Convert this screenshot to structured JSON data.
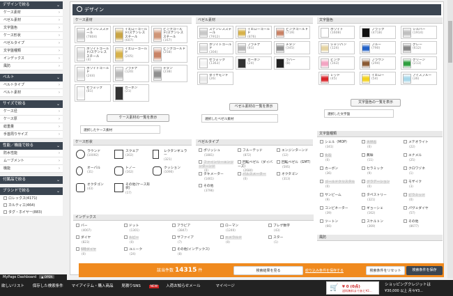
{
  "sidebar": [
    {
      "title": "デザインで絞る",
      "items": [
        "ケース素材",
        "ベゼル素材",
        "文字盤色",
        "ケース形状",
        "ベゼルタイプ",
        "文字盤種類",
        "インデックス",
        "風防"
      ]
    },
    {
      "title": "ベルト",
      "items": [
        "ベルトタイプ",
        "ベルト素材"
      ]
    },
    {
      "title": "サイズで絞る",
      "items": [
        "ケース径",
        "ケース厚",
        "総重量",
        "手首周りサイズ"
      ]
    },
    {
      "title": "性能／機能で絞る",
      "items": [
        "防水性能",
        "ムーブメント",
        "機能"
      ]
    },
    {
      "title": "付属品で絞る",
      "items": []
    },
    {
      "title": "ブランドで絞る",
      "checks": [
        "ロレックス(4171)",
        "カルティエ(464)",
        "タグ・ホイヤー(883)"
      ]
    }
  ],
  "main": {
    "title": "デザイン"
  },
  "case_material": {
    "title": "ケース素材",
    "swatches": [
      {
        "label": "ステンレススチール",
        "count": "(7804)",
        "color": "#c8c8c8"
      },
      {
        "label": "イエローゴールド/ステンレススチール",
        "count": "(607)",
        "color": "#c9a545"
      },
      {
        "label": "ピンクゴールド/ステンレススチール",
        "count": "(167)",
        "color": "#cf9577"
      },
      {
        "label": "ホワイトゴールド/ステンレススチール",
        "count": "(4)",
        "color": "#d8d8d8"
      },
      {
        "label": "イエローゴールド",
        "count": "(205)",
        "color": "#d7b24a"
      },
      {
        "label": "ピンクゴールド",
        "count": "(258)",
        "color": "#c98265"
      },
      {
        "label": "ホワイトゴールド",
        "count": "(244)",
        "color": "#dcdcdc"
      },
      {
        "label": "プラチナ",
        "count": "(120)",
        "color": "#b8b8b8"
      },
      {
        "label": "チタン",
        "count": "(238)",
        "color": "#8e8e8e"
      },
      {
        "label": "セラミック",
        "count": "(81)",
        "color": "#f3f3f3"
      },
      {
        "label": "カーボン",
        "count": "(21)",
        "color": "#333333"
      }
    ],
    "button": "ケース素材の一覧を表示",
    "selected": "選択したケース素材"
  },
  "bezel_material": {
    "title": "ベゼル素材",
    "swatches": [
      {
        "label": "ステンレススチール",
        "count": "(7912)",
        "color": "#c8c8c8"
      },
      {
        "label": "イエローゴールド",
        "count": "(876)",
        "color": "#d7b24a"
      },
      {
        "label": "ピンクゴールド",
        "count": "(719)",
        "color": "#c98265"
      },
      {
        "label": "ホワイトゴールド",
        "count": "(304)",
        "color": "#dcdcdc"
      },
      {
        "label": "プラチナ",
        "count": "(81)",
        "color": "#b8b8b8"
      },
      {
        "label": "チタン",
        "count": "(345)",
        "color": "#8e8e8e"
      },
      {
        "label": "セラミック",
        "count": "(1363)",
        "color": "#f3f3f3"
      },
      {
        "label": "カーボン",
        "count": "(24)",
        "color": "#333333"
      },
      {
        "label": "ラバー",
        "count": "(8)",
        "color": "#222222"
      },
      {
        "label": "ダイヤモンド",
        "count": "(26)",
        "color": "#e8e8e8"
      }
    ],
    "button": "ベゼル素材の一覧を表示",
    "selected": "選択したベゼル素材"
  },
  "dial_color": {
    "title": "文字盤色",
    "swatches": [
      {
        "label": "ホワイト",
        "count": "(1608)",
        "color": "#ffffff"
      },
      {
        "label": "ブラック",
        "count": "(4718)",
        "color": "#111111"
      },
      {
        "label": "シルバー",
        "count": "(1914)",
        "color": "#c0c0c0"
      },
      {
        "label": "シャンパン",
        "count": "(124)",
        "color": "#e5d3a1"
      },
      {
        "label": "ブルー",
        "count": "(790)",
        "color": "#1f5fc6"
      },
      {
        "label": "グレー",
        "count": "(612)",
        "color": "#888888"
      },
      {
        "label": "ピンク",
        "count": "(163)",
        "color": "#f3a4c2"
      },
      {
        "label": "ブラウン",
        "count": "(294)",
        "color": "#8a5a33"
      },
      {
        "label": "グリーン",
        "count": "(213)",
        "color": "#2e9f3e"
      },
      {
        "label": "レッド",
        "count": "(45)",
        "color": "#d9252b"
      },
      {
        "label": "イエロー",
        "count": "(54)",
        "color": "#f3d21f"
      },
      {
        "label": "アイスブルー",
        "count": "(36)",
        "color": "#a9d8ea"
      }
    ],
    "button": "文字盤色の一覧を表示",
    "selected": "選択した文字盤"
  },
  "case_shape": {
    "title": "ケース形状",
    "items": [
      {
        "label": "ラウンド",
        "count": "(10092)",
        "shape": "circle"
      },
      {
        "label": "スクエア",
        "count": "(302)",
        "shape": "square"
      },
      {
        "label": "レクタンギュラー",
        "count": "(321)",
        "shape": "rect"
      },
      {
        "label": "オーバル",
        "count": "(31)",
        "shape": "oval"
      },
      {
        "label": "トノー",
        "count": "(162)",
        "shape": "tonneau"
      },
      {
        "label": "クッション",
        "count": "(1090)",
        "shape": "cushion"
      },
      {
        "label": "オクタゴン",
        "count": "(43)",
        "shape": "octagon"
      },
      {
        "label": "その他(ケース形状)",
        "count": "(17)",
        "shape": "other"
      }
    ]
  },
  "bezel_type": {
    "title": "ベゼルタイプ",
    "items": [
      {
        "label": "ポリッシュ",
        "count": "(1881)",
        "disabled": false
      },
      {
        "label": "フルーテッド",
        "count": "(872)",
        "disabled": false
      },
      {
        "label": "エンジンターンド",
        "count": "(12)",
        "disabled": false
      },
      {
        "label": "ファインリーエンジンターンド",
        "count": "(0)",
        "disabled": true
      },
      {
        "label": "回転ベゼル（ダイバーズ）",
        "count": "(2680)",
        "disabled": false
      },
      {
        "label": "回転ベゼル（GMT）",
        "count": "(595)",
        "disabled": false
      },
      {
        "label": "タキメーター",
        "count": "(1461)",
        "disabled": false
      },
      {
        "label": "パルスメーター",
        "count": "(0)",
        "disabled": true
      },
      {
        "label": "オクタゴン",
        "count": "(313)",
        "disabled": false
      },
      {
        "label": "その他",
        "count": "(3796)",
        "disabled": false
      }
    ]
  },
  "dial_type": {
    "title": "文字盤種類",
    "items": [
      {
        "label": "シェル（MOP）",
        "count": "(341)",
        "disabled": false
      },
      {
        "label": "天然石",
        "count": "(0)",
        "disabled": true
      },
      {
        "label": "メテオライト",
        "count": "(22)",
        "disabled": false
      },
      {
        "label": "化石",
        "count": "(0)",
        "disabled": true
      },
      {
        "label": "無垢",
        "count": "(11)",
        "disabled": false
      },
      {
        "label": "エナメル",
        "count": "(25)",
        "disabled": false
      },
      {
        "label": "カーボン",
        "count": "(36)",
        "disabled": false
      },
      {
        "label": "セラミック",
        "count": "(9)",
        "disabled": false
      },
      {
        "label": "クロワゾネ",
        "count": "(1)",
        "disabled": false
      },
      {
        "label": "ゴールドクリスタル",
        "count": "(0)",
        "disabled": true
      },
      {
        "label": "グラデーション",
        "count": "(0)",
        "disabled": true
      },
      {
        "label": "モザイク",
        "count": "(3)",
        "disabled": false
      },
      {
        "label": "サンビーム",
        "count": "(9)",
        "disabled": false
      },
      {
        "label": "タペストリー",
        "count": "(321)",
        "disabled": false
      },
      {
        "label": "ピラミッド",
        "count": "(0)",
        "disabled": true
      },
      {
        "label": "コンビネーター",
        "count": "(39)",
        "disabled": false
      },
      {
        "label": "ギョーシェ",
        "count": "(162)",
        "disabled": false
      },
      {
        "label": "パヴェダイヤ",
        "count": "(57)",
        "disabled": false
      },
      {
        "label": "ツートン",
        "count": "(66)",
        "disabled": false
      },
      {
        "label": "スケルトン",
        "count": "(369)",
        "disabled": false
      },
      {
        "label": "その他",
        "count": "(8677)",
        "disabled": false
      }
    ]
  },
  "index": {
    "title": "インデックス",
    "items": [
      {
        "label": "バー",
        "count": "(4007)",
        "disabled": false
      },
      {
        "label": "ドット",
        "count": "(1301)",
        "disabled": false
      },
      {
        "label": "アラビア",
        "count": "(3847)",
        "disabled": false
      },
      {
        "label": "ローマン",
        "count": "(1240)",
        "disabled": false
      },
      {
        "label": "ブレゲ数字",
        "count": "(43)",
        "disabled": false
      },
      {
        "label": "ダイヤ",
        "count": "(823)",
        "disabled": false
      },
      {
        "label": "ルビー",
        "count": "(0)",
        "disabled": true
      },
      {
        "label": "サファイア",
        "count": "(7)",
        "disabled": false
      },
      {
        "label": "エメラルド",
        "count": "(0)",
        "disabled": true
      },
      {
        "label": "スター",
        "count": "(1)",
        "disabled": false
      },
      {
        "label": "6時ダイヤ",
        "count": "(0)",
        "disabled": true
      },
      {
        "label": "ユニーク",
        "count": "(24)",
        "disabled": false
      },
      {
        "label": "その他(インデックス)",
        "count": "(8)",
        "disabled": false
      }
    ]
  },
  "windshield": {
    "title": "風防"
  },
  "orange_bar": {
    "count_label": "該当件数",
    "count": "14315",
    "count_unit": "件",
    "view_button": "検索結果を見る",
    "condition_link": "絞り込み条件を保存する",
    "reset_button": "検索条件をリセット",
    "save_button": "検索条件を保存"
  },
  "bottom_bar": {
    "mypage_tab": "MyPage Dashboard",
    "mypage_state": "▲ OPEN",
    "nav": [
      "欲しいリスト",
      "保存した検索条件",
      "マイアイテム・購入商品",
      "見積りSNS"
    ],
    "new_badge": "NEW",
    "new_text": "入荷お知らせメール",
    "mypage": "マイページ",
    "cart_amount": "¥ 0 (0点)",
    "cart_sub": "送料無料まであと¥2...",
    "credit_label": "ショッピングクレジットは",
    "credit_value": "¥30,000 以上 月々¥3..."
  }
}
